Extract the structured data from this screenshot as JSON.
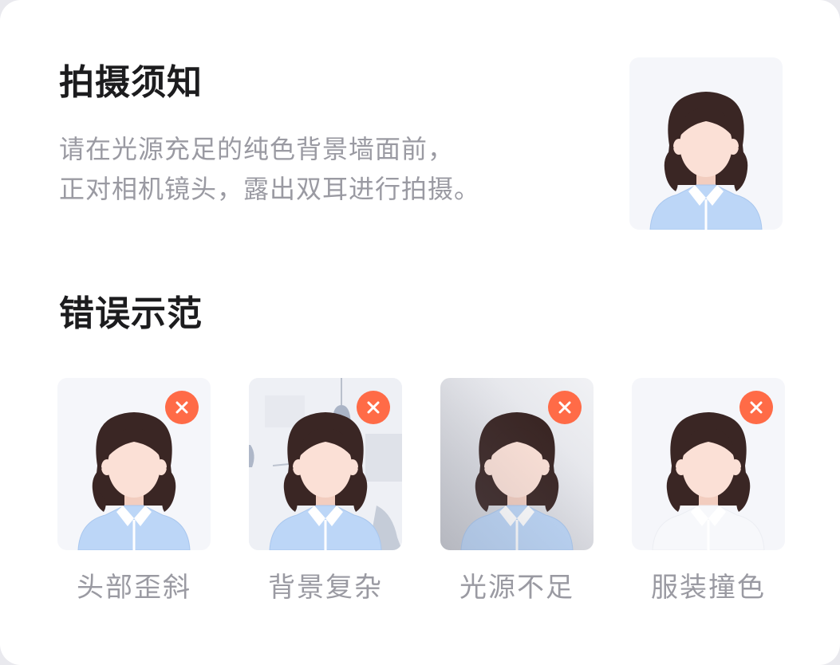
{
  "instructions": {
    "title": "拍摄须知",
    "desc_line1": "请在光源充足的纯色背景墙面前，",
    "desc_line2": "正对相机镜头，露出双耳进行拍摄。"
  },
  "errors": {
    "title": "错误示范",
    "items": [
      {
        "label": "头部歪斜",
        "icon": "close-icon"
      },
      {
        "label": "背景复杂",
        "icon": "close-icon"
      },
      {
        "label": "光源不足",
        "icon": "close-icon"
      },
      {
        "label": "服装撞色",
        "icon": "close-icon"
      }
    ]
  },
  "colors": {
    "error_badge": "#ff6b47",
    "shirt": "#bcd6f7",
    "hair": "#3a2624",
    "skin": "#fbe0d6",
    "thumb_bg": "#f5f6fa"
  }
}
